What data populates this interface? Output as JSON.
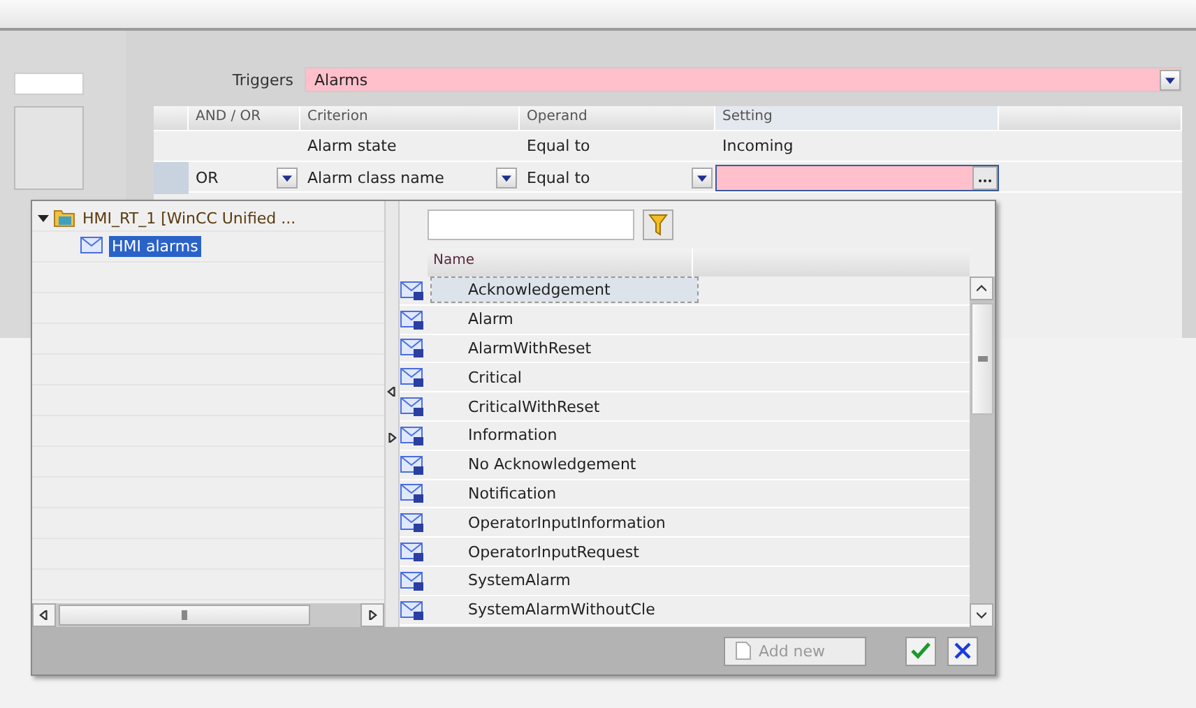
{
  "triggers": {
    "label": "Triggers",
    "value": "Alarms"
  },
  "grid": {
    "columns": [
      "AND / OR",
      "Criterion",
      "Operand",
      "Setting"
    ],
    "rows": [
      {
        "and_or": "",
        "criterion": "Alarm state",
        "operand": "Equal to",
        "setting": "Incoming",
        "editable": false
      },
      {
        "and_or": "OR",
        "criterion": "Alarm class name",
        "operand": "Equal to",
        "setting": "",
        "editable": true
      }
    ]
  },
  "picker": {
    "tree": [
      {
        "label": "HMI_RT_1 [WinCC Unified ...",
        "expanded": true,
        "selected": false,
        "children": [
          {
            "label": "HMI alarms",
            "selected": true
          }
        ]
      }
    ],
    "list_header": "Name",
    "items": [
      {
        "label": "Acknowledgement",
        "selected": true
      },
      {
        "label": "Alarm",
        "selected": false
      },
      {
        "label": "AlarmWithReset",
        "selected": false
      },
      {
        "label": "Critical",
        "selected": false
      },
      {
        "label": "CriticalWithReset",
        "selected": false
      },
      {
        "label": "Information",
        "selected": false
      },
      {
        "label": "No Acknowledgement",
        "selected": false
      },
      {
        "label": "Notification",
        "selected": false
      },
      {
        "label": "OperatorInputInformation",
        "selected": false
      },
      {
        "label": "OperatorInputRequest",
        "selected": false
      },
      {
        "label": "SystemAlarm",
        "selected": false
      },
      {
        "label": "SystemAlarmWithoutCle",
        "selected": false
      }
    ],
    "add_button": {
      "label": "Add new",
      "disabled": true
    }
  }
}
